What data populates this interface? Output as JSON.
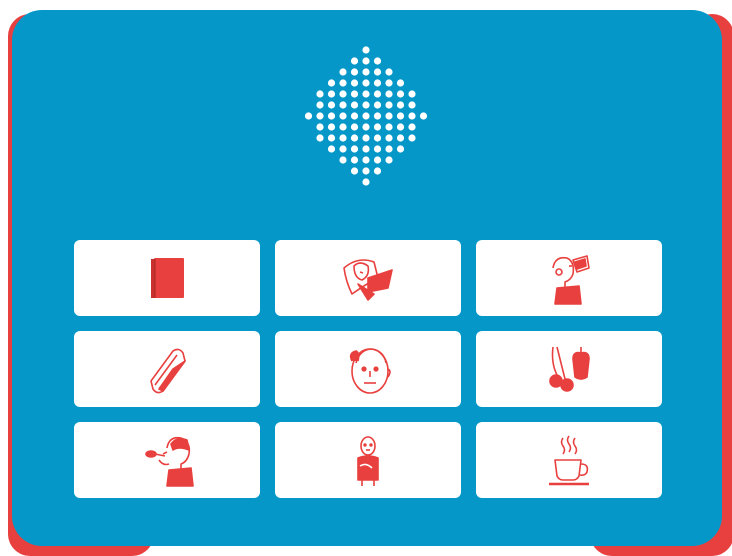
{
  "colors": {
    "panel": "#0597c8",
    "bumper": "#e8403e",
    "tile": "#ffffff",
    "pictogram": "#e8403e",
    "speaker_dots": "#ffffff"
  },
  "speaker": {
    "icon": "speaker-grille"
  },
  "buttons": [
    {
      "icon": "book-icon"
    },
    {
      "icon": "sleep-on-pillow-icon"
    },
    {
      "icon": "drink-icon"
    },
    {
      "icon": "wallet-icon"
    },
    {
      "icon": "face-icon"
    },
    {
      "icon": "fruit-icon"
    },
    {
      "icon": "eat-with-spoon-icon"
    },
    {
      "icon": "person-icon"
    },
    {
      "icon": "hot-drink-cup-icon"
    }
  ]
}
